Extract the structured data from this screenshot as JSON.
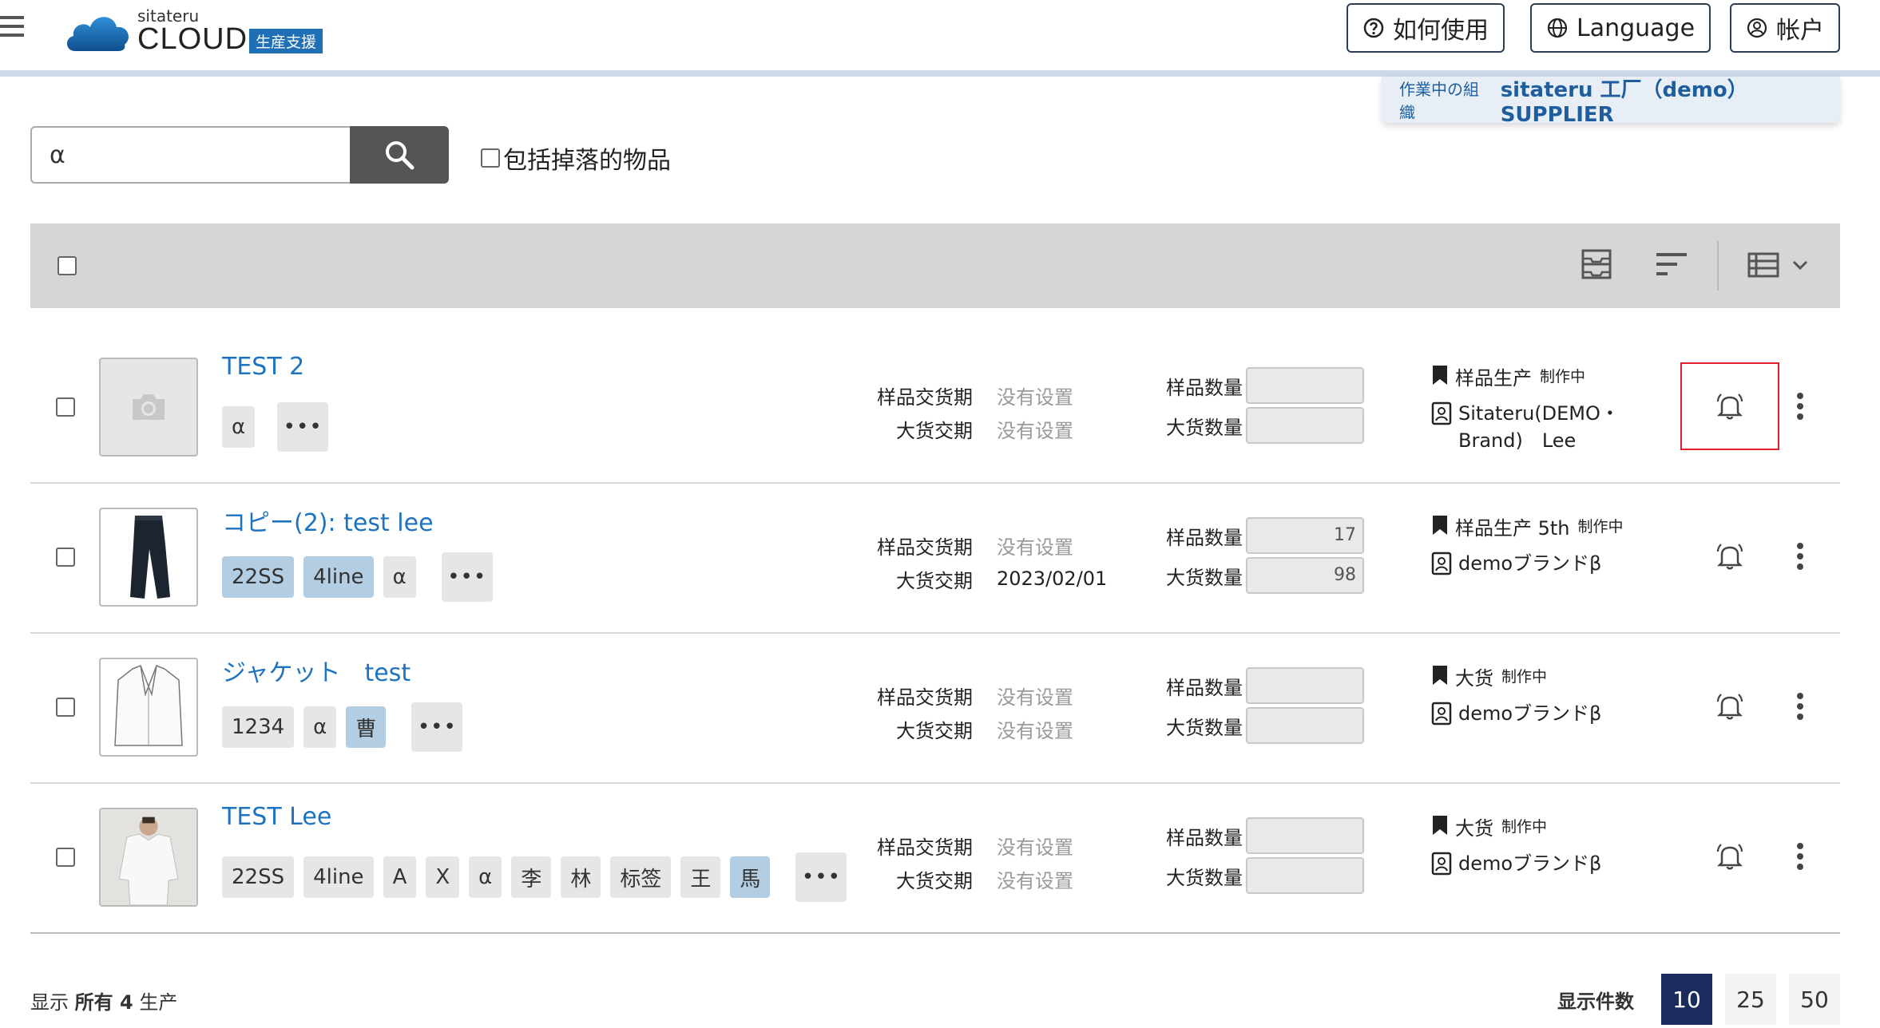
{
  "header": {
    "logo_small": "sitateru",
    "logo_big": "CLOUD",
    "logo_badge": "生産支援",
    "help_label": "如何使用",
    "language_label": "Language",
    "account_label": "帐户"
  },
  "org": {
    "label": "作業中の組織",
    "value": "sitateru 工厂（demo） SUPPLIER"
  },
  "search": {
    "value": "α",
    "include_dropped_label": "包括掉落的物品"
  },
  "rows": [
    {
      "name": "TEST 2",
      "tags": [
        "α"
      ],
      "sample_delivery_label": "样品交货期",
      "sample_delivery": "没有设置",
      "bulk_delivery_label": "大货交期",
      "bulk_delivery": "没有设置",
      "sample_qty_label": "样品数量",
      "sample_qty": "",
      "bulk_qty_label": "大货数量",
      "bulk_qty": "",
      "phase": "样品生产",
      "status": "制作中",
      "brand": "Sitateru(DEMO・Brand)　Lee"
    },
    {
      "name": "コピー(2): test lee",
      "tags": [
        "22SS",
        "4line",
        "α"
      ],
      "sample_delivery_label": "样品交货期",
      "sample_delivery": "没有设置",
      "bulk_delivery_label": "大货交期",
      "bulk_delivery": "2023/02/01",
      "sample_qty_label": "样品数量",
      "sample_qty": "17",
      "bulk_qty_label": "大货数量",
      "bulk_qty": "98",
      "phase": "样品生产 5th",
      "status": "制作中",
      "brand": "demoブランドβ"
    },
    {
      "name": "ジャケット　test",
      "tags": [
        "1234",
        "α",
        "曹"
      ],
      "sample_delivery_label": "样品交货期",
      "sample_delivery": "没有设置",
      "bulk_delivery_label": "大货交期",
      "bulk_delivery": "没有设置",
      "sample_qty_label": "样品数量",
      "sample_qty": "",
      "bulk_qty_label": "大货数量",
      "bulk_qty": "",
      "phase": "大货",
      "status": "制作中",
      "brand": "demoブランドβ"
    },
    {
      "name": "TEST Lee",
      "tags": [
        "22SS",
        "4line",
        "A",
        "X",
        "α",
        "李",
        "林",
        "标签",
        "王",
        "馬"
      ],
      "sample_delivery_label": "样品交货期",
      "sample_delivery": "没有设置",
      "bulk_delivery_label": "大货交期",
      "bulk_delivery": "没有设置",
      "sample_qty_label": "样品数量",
      "sample_qty": "",
      "bulk_qty_label": "大货数量",
      "bulk_qty": "",
      "phase": "大货",
      "status": "制作中",
      "brand": "demoブランドβ"
    }
  ],
  "footer": {
    "show_prefix": "显示",
    "show_count": "所有 4",
    "show_suffix": "生产",
    "per_page_label": "显示件数",
    "per_page_options": [
      "10",
      "25",
      "50"
    ]
  },
  "colors": {
    "accent": "#1e73be",
    "badge": "#1e6fb5",
    "active_page": "#1a2b5e",
    "highlight": "#e0202a"
  }
}
